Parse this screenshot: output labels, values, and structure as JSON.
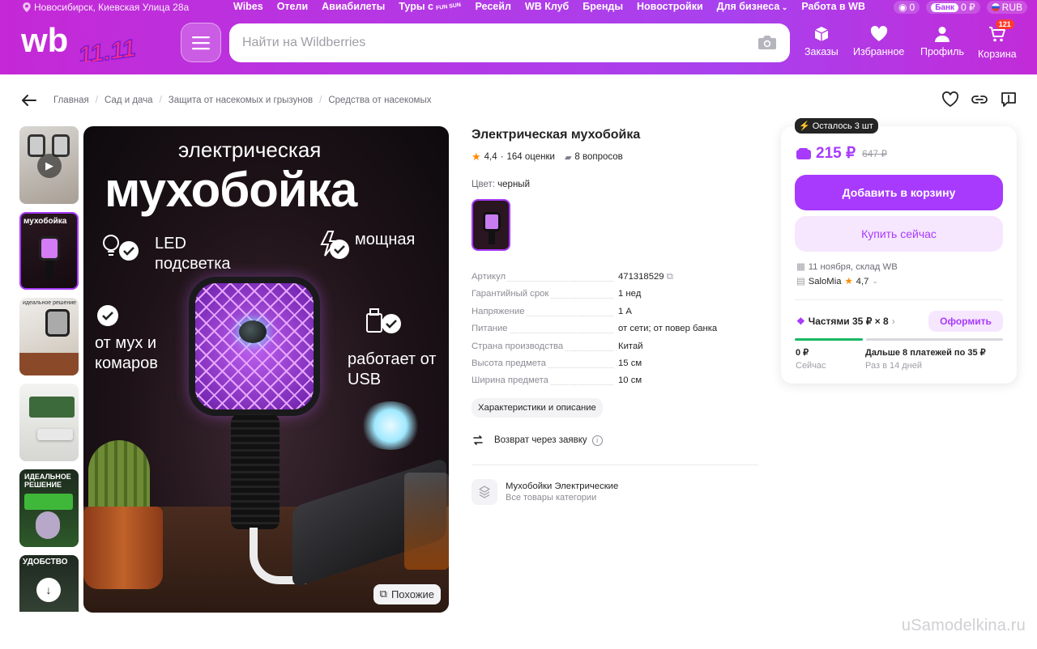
{
  "header": {
    "location": "Новосибирск, Киевская Улица 28а",
    "nav": [
      "Wibes",
      "Отели",
      "Авиабилеты",
      "Туры с",
      "Ресейл",
      "WB Клуб",
      "Бренды",
      "Новостройки",
      "Для бизнеса",
      "Работа в WB"
    ],
    "tours_brand": "FUN SUN",
    "bonus_points": "0",
    "bank_label": "Банк",
    "bank_balance": "0 ₽",
    "currency": "RUB",
    "logo_text": "wb",
    "logo_sale": "11.11",
    "search_placeholder": "Найти на Wildberries",
    "nav_icons": [
      {
        "label": "Заказы",
        "icon": "box-icon"
      },
      {
        "label": "Избранное",
        "icon": "heart-icon"
      },
      {
        "label": "Профиль",
        "icon": "user-icon"
      },
      {
        "label": "Корзина",
        "icon": "cart-icon"
      }
    ],
    "cart_count": "121"
  },
  "breadcrumbs": [
    "Главная",
    "Сад и дача",
    "Защита от насекомых и грызунов",
    "Средства от насекомых"
  ],
  "gallery": {
    "thumb_labels": [
      "",
      "мухобойка",
      "идеальное решение",
      "",
      "ИДЕАЛЬНОЕ РЕШЕНИЕ",
      "УДОБСТВО"
    ],
    "main": {
      "line1": "электрическая",
      "line2": "мухобойка",
      "feature1": "LED подсветка",
      "feature2": "мощная",
      "feature3": "от мух и комаров",
      "feature4": "работает от USB"
    },
    "similar_label": "Похожие"
  },
  "product": {
    "title": "Электрическая мухобойка",
    "rating": "4,4",
    "reviews": "164 оценки",
    "questions": "8 вопросов",
    "color_label": "Цвет:",
    "color_value": "черный",
    "specs": [
      {
        "k": "Артикул",
        "v": "471318529"
      },
      {
        "k": "Гарантийный срок",
        "v": "1 нед"
      },
      {
        "k": "Напряжение",
        "v": "1 А"
      },
      {
        "k": "Питание",
        "v": "от сети; от повер банка"
      },
      {
        "k": "Страна производства",
        "v": "Китай"
      },
      {
        "k": "Высота предмета",
        "v": "15 см"
      },
      {
        "k": "Ширина предмета",
        "v": "10 см"
      }
    ],
    "chars_button": "Характеристики и описание",
    "returns": "Возврат через заявку",
    "category_name": "Мухобойки Электрические",
    "category_sub": "Все товары категории"
  },
  "buy": {
    "stock_badge": "Осталось 3 шт",
    "price": "215 ₽",
    "old_price": "647 ₽",
    "add_to_cart": "Добавить в корзину",
    "buy_now": "Купить сейчас",
    "delivery": "11 ноября, склад WB",
    "seller": "SaloMia",
    "seller_rating": "4,7",
    "installments": "Частями 35 ₽ × 8",
    "checkout": "Оформить",
    "pay_now": "0 ₽",
    "pay_now_sub": "Сейчас",
    "pay_later": "Дальше 8 платежей по 35 ₽",
    "pay_later_sub": "Раз в 14 дней"
  },
  "watermark": "uSamodelkina.ru",
  "colors": {
    "accent": "#a73afd",
    "header": "#b83ae4",
    "green": "#18b964"
  }
}
